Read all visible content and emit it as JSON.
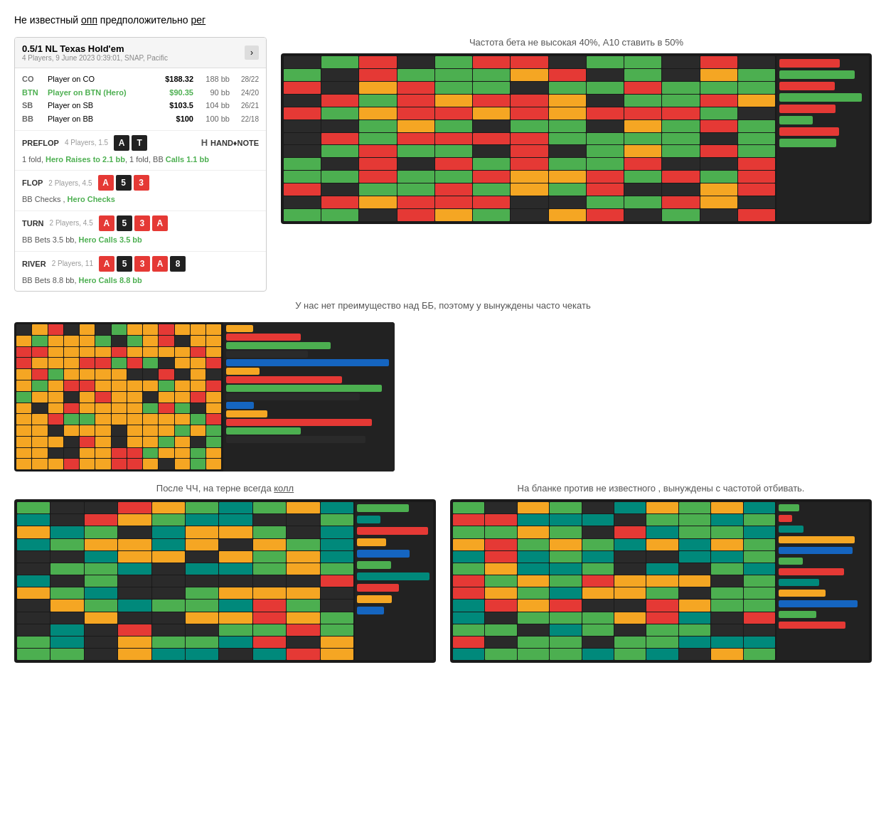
{
  "page": {
    "top_text": "Не известный опп предположительно рег",
    "top_text_underline1": "опп",
    "top_text_underline2": "рег"
  },
  "hand_card": {
    "title": "0.5/1 NL Texas Hold'em",
    "meta": "4 Players, 9 June 2023 0:39:01, SNAP, Pacific",
    "players": [
      {
        "pos": "CO",
        "pos_class": "",
        "name": "Player on CO",
        "name_class": "",
        "amount": "$188.32",
        "bb": "188 bb",
        "stat": "28/22"
      },
      {
        "pos": "BTN",
        "pos_class": "btn",
        "name": "Player on BTN (Hero)",
        "name_class": "hero",
        "amount": "$90.35",
        "bb": "90 bb",
        "stat": "24/20"
      },
      {
        "pos": "SB",
        "pos_class": "",
        "name": "Player on SB",
        "name_class": "",
        "amount": "$103.5",
        "bb": "104 bb",
        "stat": "26/21"
      },
      {
        "pos": "BB",
        "pos_class": "",
        "name": "Player on BB",
        "name_class": "",
        "amount": "$100",
        "bb": "100 bb",
        "stat": "22/18"
      }
    ],
    "preflop": {
      "label": "PREFLOP",
      "info": "4 Players, 1.5",
      "hero_cards": [
        "A",
        "T"
      ],
      "action": "1 fold, Hero Raises to 2.1 bb, 1 fold, BB Calls 1.1 bb",
      "action_parts": {
        "normal": "1 fold, Hero Raises to 2.1 bb, 1 fold, BB ",
        "highlight": "Calls 1.1 bb",
        "hero_part": "Hero Raises to 2.1 bb"
      },
      "logo_text": "HAND♦NOTE"
    },
    "flop": {
      "label": "FLOP",
      "info": "2 Players, 4.5",
      "cards": [
        "A",
        "5",
        "3"
      ],
      "action_bb": "BB Checks , ",
      "action_hero": "Hero Checks"
    },
    "turn": {
      "label": "TURN",
      "info": "2 Players, 4.5",
      "cards": [
        "A",
        "5",
        "3",
        "A"
      ],
      "action_bb": "BB Bets 3.5 bb, ",
      "action_hero": "Hero Calls 3.5 bb"
    },
    "river": {
      "label": "RIVER",
      "info": "2 Players, 11",
      "cards": [
        "A",
        "5",
        "3",
        "A",
        "8"
      ],
      "action_bb": "BB Bets 8.8 bb, ",
      "action_hero": "Hero Calls 8.8 bb"
    }
  },
  "below_card_text": "У нас нет преимущество над ББ, поэтому у вынуждены часто чекать",
  "panel_top_right": {
    "caption": "Частота бета не высокая 40%,  A10 ставить в 50%"
  },
  "panel_bottom_left": {
    "caption_normal": "После ЧЧ, на терне всегда ",
    "caption_underline": "колл"
  },
  "panel_bottom_right": {
    "caption": "На бланке против не известного , вынуждены с частотой отбивать."
  },
  "colors": {
    "orange": "#f5a623",
    "green": "#4caf50",
    "red": "#e53935",
    "dark_green": "#2e7d32",
    "blue": "#1565c0",
    "teal": "#00897b",
    "dark_bg": "#1a1a1a",
    "medium_bg": "#2a2a2a"
  }
}
